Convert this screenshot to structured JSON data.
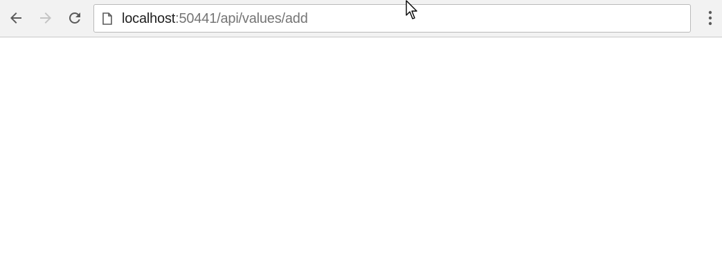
{
  "browser": {
    "address_bar": {
      "host": "localhost",
      "rest": ":50441/api/values/add"
    },
    "icons": {
      "back": "arrow-left-icon",
      "forward": "arrow-right-icon",
      "reload": "reload-icon",
      "page": "page-icon",
      "menu": "kebab-menu-icon",
      "cursor": "mouse-pointer-icon"
    },
    "colors": {
      "toolbar_bg": "#f2f2f2",
      "icon_active": "#5a5a5a",
      "icon_disabled": "#c4c4c4",
      "url_host": "#202020",
      "url_path": "#757575"
    }
  }
}
